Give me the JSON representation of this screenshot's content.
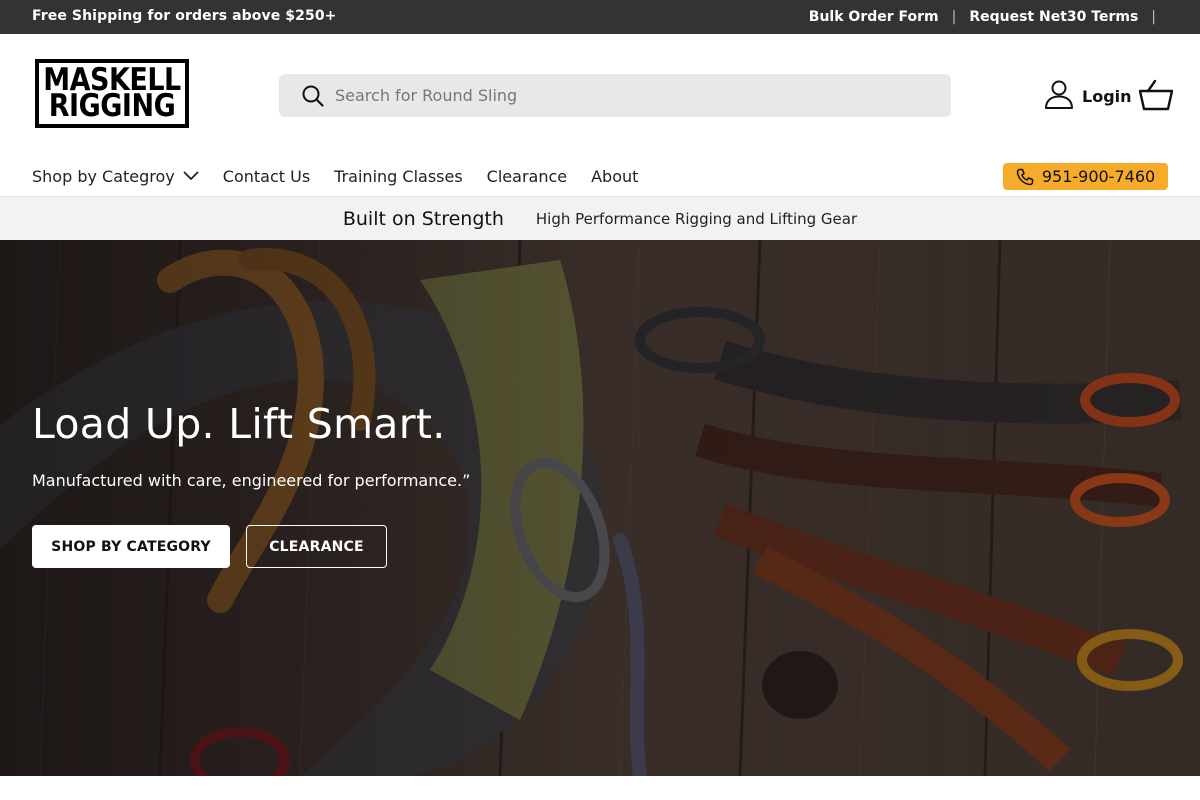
{
  "topbar": {
    "promo": "Free Shipping for orders above $250+",
    "links": [
      {
        "label": "Bulk Order Form"
      },
      {
        "label": "Request Net30 Terms"
      }
    ],
    "separator": "|"
  },
  "header": {
    "logo_line1": "MASKELL",
    "logo_line2": "RIGGING",
    "search_placeholder": "Search for Round Sling",
    "login_label": "Login",
    "icons": {
      "search": "search-icon",
      "account": "user-icon",
      "cart": "basket-icon"
    }
  },
  "nav": {
    "items": [
      {
        "label": "Shop by Categroy",
        "has_dropdown": true
      },
      {
        "label": "Contact Us"
      },
      {
        "label": "Training Classes"
      },
      {
        "label": "Clearance"
      },
      {
        "label": "About"
      }
    ],
    "phone": "951-900-7460",
    "phone_color": "#f6ac2a"
  },
  "strip": {
    "headline": "Built on Strength",
    "subline": "High Performance Rigging and Lifting Gear"
  },
  "hero": {
    "title": "Load Up. Lift Smart.",
    "subtitle": "Manufactured with care, engineered for performance.”",
    "primary_button": "SHOP BY CATEGORY",
    "secondary_button": "CLEARANCE"
  },
  "colors": {
    "topbar_bg": "#333333",
    "accent": "#f6ac2a",
    "strip_bg": "#f2f2f2"
  }
}
